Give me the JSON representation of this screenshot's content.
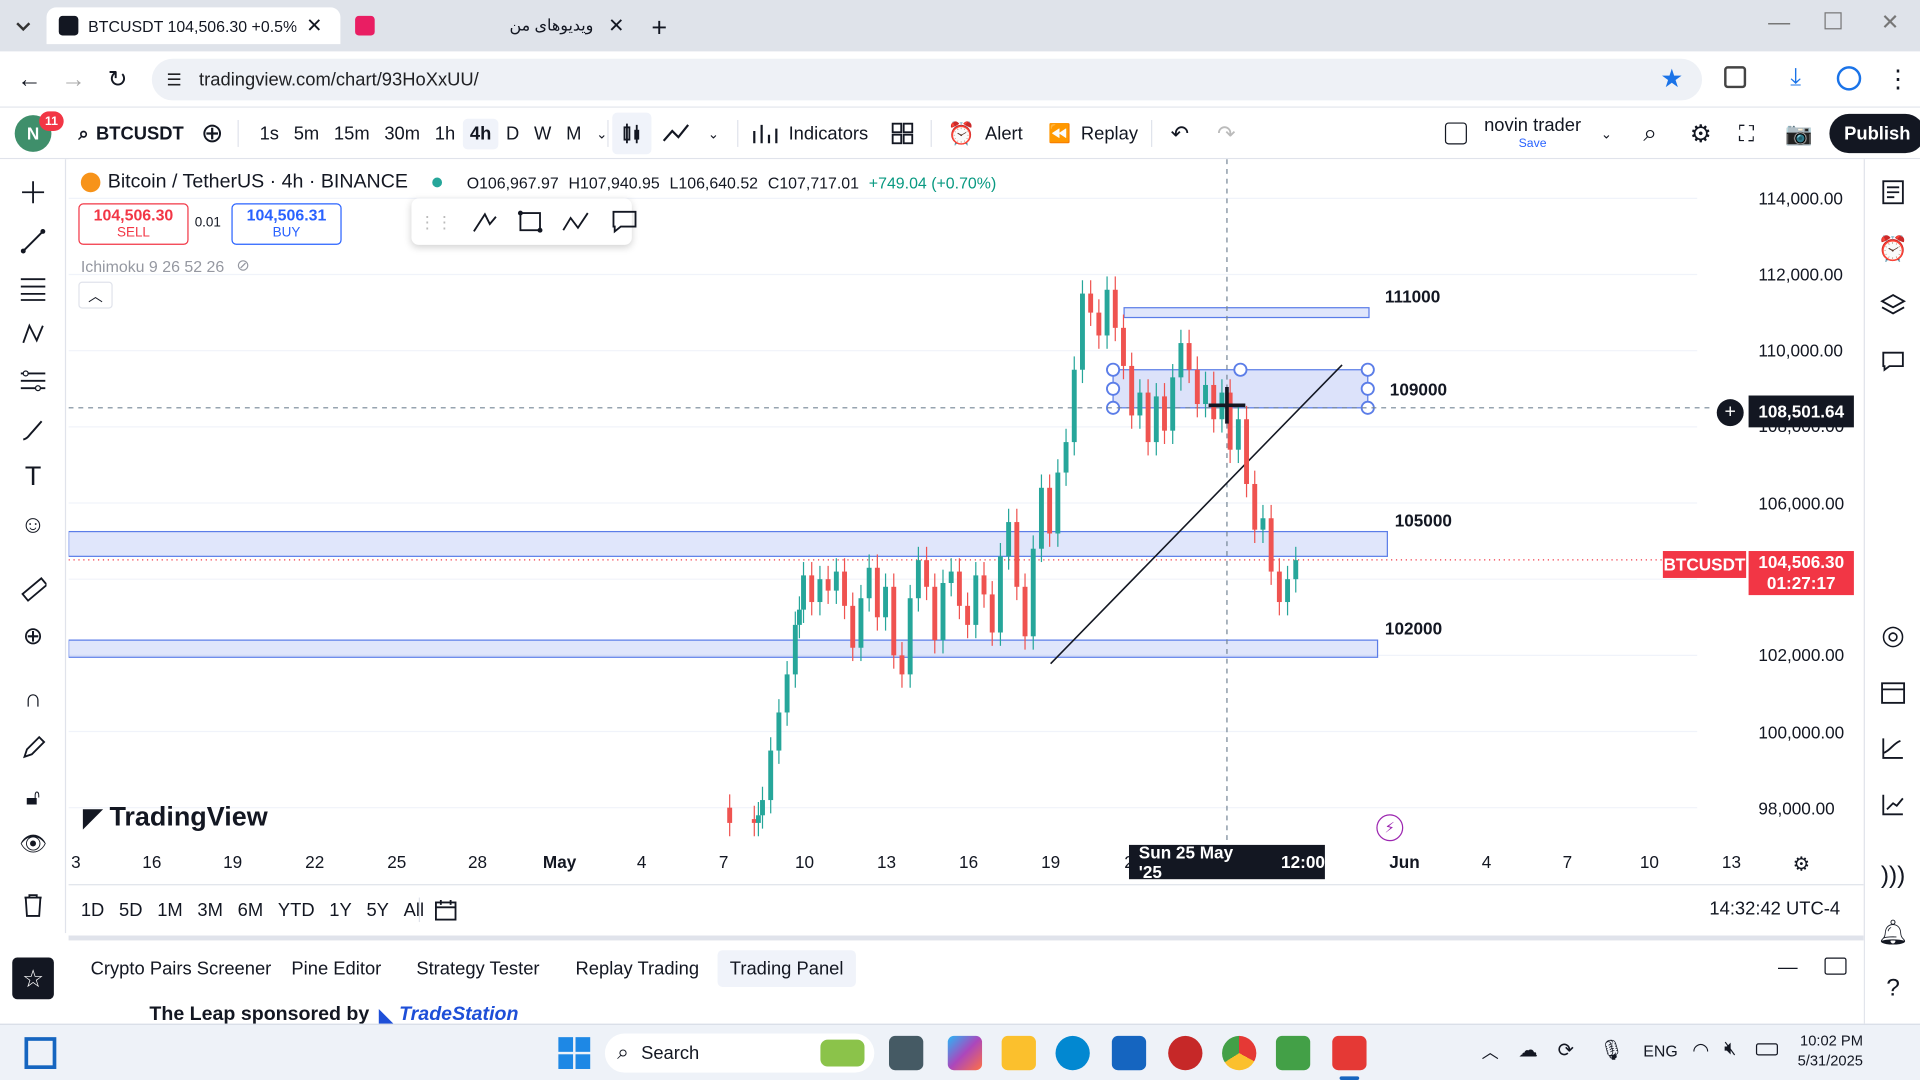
{
  "browser": {
    "tabs": [
      {
        "label": "BTCUSDT 104,506.30 +0.5% …"
      },
      {
        "label": "ویدیوهای من"
      }
    ],
    "url": "tradingview.com/chart/93HoXxUU/"
  },
  "toolbar": {
    "avatar_letter": "N",
    "notif_count": "11",
    "symbol": "BTCUSDT",
    "intervals": [
      "1s",
      "5m",
      "15m",
      "30m",
      "1h",
      "4h",
      "D",
      "W",
      "M"
    ],
    "active_interval": "4h",
    "indicators_label": "Indicators",
    "alert_label": "Alert",
    "replay_label": "Replay",
    "layout_name": "novin trader",
    "save_label": "Save",
    "publish_label": "Publish"
  },
  "legend": {
    "title": "Bitcoin / TetherUS · 4h · BINANCE",
    "o": "O106,967.97",
    "h": "H107,940.95",
    "l": "L106,640.52",
    "c": "C107,717.01",
    "change": "+749.04 (+0.70%)",
    "sell_price": "104,506.30",
    "sell_label": "SELL",
    "spread": "0.01",
    "buy_price": "104,506.31",
    "buy_label": "BUY",
    "indicator": "Ichimoku 9 26 52 26"
  },
  "price_axis": [
    "114,000.00",
    "112,000.00",
    "110,000.00",
    "108,000.00",
    "106,000.00",
    "102,000.00",
    "100,000.00",
    "98,000.00"
  ],
  "crosshair_price": "108,501.64",
  "symbol_tag": "BTCUSDT",
  "last_price": "104,506.30",
  "countdown": "01:27:17",
  "date_axis": [
    "3",
    "16",
    "19",
    "22",
    "25",
    "28",
    "May",
    "4",
    "7",
    "10",
    "13",
    "16",
    "19",
    "2",
    "Jun",
    "4",
    "7",
    "10",
    "13"
  ],
  "crosshair_date": "Sun 25 May '25",
  "crosshair_time": "12:00",
  "levels": [
    "111000",
    "109000",
    "105000",
    "102000"
  ],
  "watermark": "TradingView",
  "timeframes": [
    "1D",
    "5D",
    "1M",
    "3M",
    "6M",
    "YTD",
    "1Y",
    "5Y",
    "All"
  ],
  "clock": "14:32:42 UTC-4",
  "bottom_tabs": [
    "Crypto Pairs Screener",
    "Pine Editor",
    "Strategy Tester",
    "Replay Trading",
    "Trading Panel"
  ],
  "active_bottom_tab": "Trading Panel",
  "sponsor_text": "The Leap sponsored by",
  "sponsor_brand": "TradeStation",
  "taskbar": {
    "search": "Search",
    "lang": "ENG",
    "time": "10:02 PM",
    "date": "5/31/2025"
  },
  "colors": {
    "accent": "#2962ff",
    "up": "#26a69a",
    "down": "#ef5350",
    "red_tag": "#f23645",
    "box": "#5b7de8"
  }
}
